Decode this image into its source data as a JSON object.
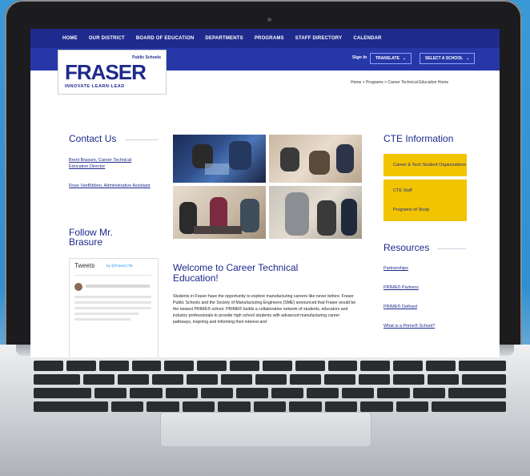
{
  "nav": {
    "items": [
      "HOME",
      "OUR DISTRICT",
      "BOARD OF EDUCATION",
      "DEPARTMENTS",
      "PROGRAMS",
      "STAFF DIRECTORY",
      "CALENDAR"
    ]
  },
  "subnav": {
    "sign_in": "Sign In",
    "translate": "TRANSLATE",
    "select_school": "SELECT A SCHOOL"
  },
  "logo": {
    "name": "FRASER",
    "public_schools": "Public Schools",
    "tagline": "INNOVATE·LEARN·LEAD"
  },
  "breadcrumb": "Home > Programs > Career Technical Education Home",
  "contact": {
    "heading": "Contact Us",
    "links": [
      "Brent Brasure, Career Technical Education Director",
      "Rose VanBibbon, Administrative Assistant"
    ]
  },
  "follow": {
    "heading": "Follow Mr. Brasure",
    "tweets_title": "Tweets",
    "tweets_by": "by @FraserCTE"
  },
  "main": {
    "welcome": "Welcome to Career Technical Education!",
    "body": "Students in Fraser have the opportunity to explore manufacturing careers like never before. Fraser Public Schools and the Society of Manufacturing Engineers (SME) announced that Fraser would be the newest PRIME® school. PRIME® builds a collaborative network of students, educators and industry professionals to provide high school students with advanced manufacturing career pathways, inspiring and informing their interest and"
  },
  "cte": {
    "heading": "CTE Information",
    "buttons": [
      "Career & Tech Student Organizations",
      "CTE Staff",
      "Programs of Study"
    ]
  },
  "resources": {
    "heading": "Resources",
    "links": [
      "Partnerships",
      "PRIME® Partners",
      "PRIME® Defined",
      "What is a Prime® School?"
    ]
  },
  "colors": {
    "nav": "#1e2a8c",
    "accent": "#f2c400"
  }
}
